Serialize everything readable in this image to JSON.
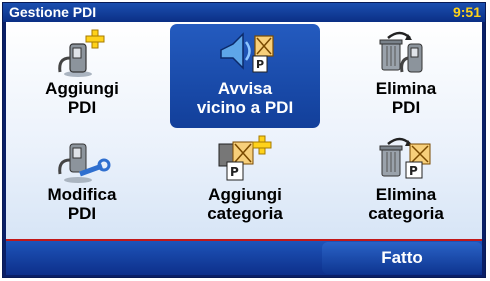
{
  "titlebar": {
    "title": "Gestione PDI",
    "clock": "9:51"
  },
  "menu": {
    "items": [
      {
        "line1": "Aggiungi",
        "line2": "PDI",
        "icon": "add-poi-icon"
      },
      {
        "line1": "Avvisa",
        "line2": "vicino a PDI",
        "icon": "warn-near-poi-icon",
        "selected": true
      },
      {
        "line1": "Elimina",
        "line2": "PDI",
        "icon": "delete-poi-icon"
      },
      {
        "line1": "Modifica",
        "line2": "PDI",
        "icon": "edit-poi-icon"
      },
      {
        "line1": "Aggiungi",
        "line2": "categoria",
        "icon": "add-category-icon"
      },
      {
        "line1": "Elimina",
        "line2": "categoria",
        "icon": "delete-category-icon"
      }
    ]
  },
  "footer": {
    "done_label": "Fatto"
  },
  "colors": {
    "accent": "#1a4fb5",
    "clock": "#ffd21a",
    "separator": "#c21818"
  }
}
